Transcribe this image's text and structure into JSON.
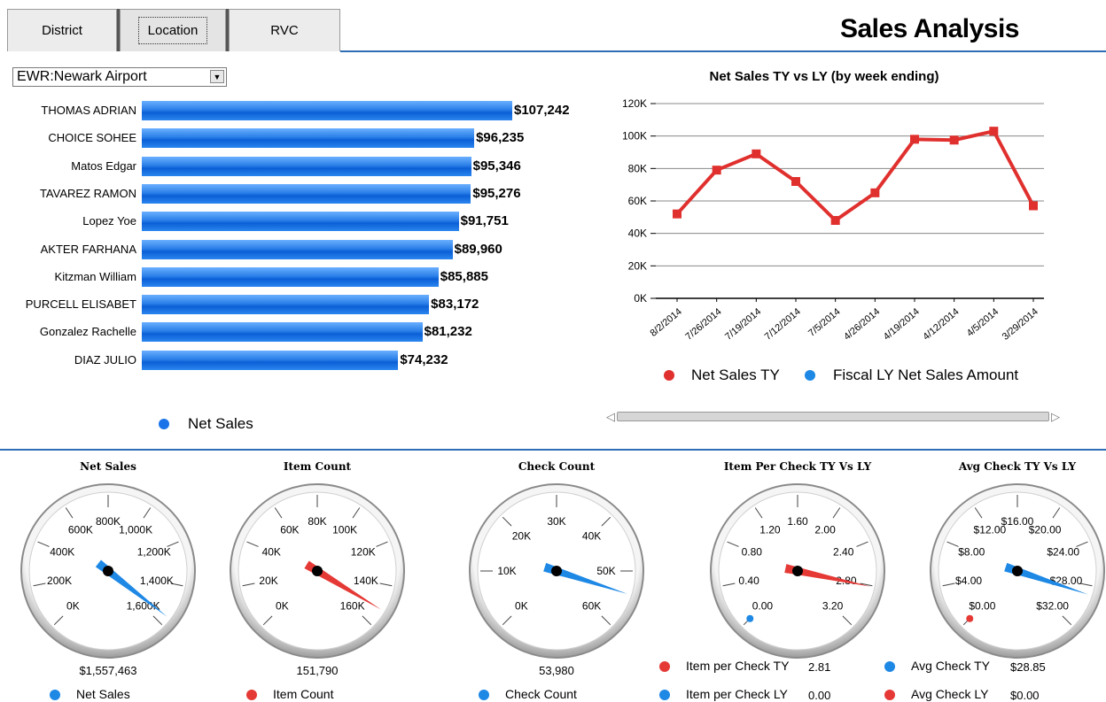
{
  "tabs": [
    "District",
    "Location",
    "RVC"
  ],
  "active_tab": 1,
  "title": "Sales Analysis",
  "location_select": {
    "value": "EWR:Newark Airport"
  },
  "bar_chart": {
    "type": "bar",
    "categories": [
      "THOMAS ADRIAN",
      "CHOICE SOHEE",
      "Matos Edgar",
      "TAVAREZ RAMON",
      "Lopez Yoe",
      "AKTER FARHANA",
      "Kitzman William",
      "PURCELL ELISABET",
      "Gonzalez Rachelle",
      "DIAZ JULIO"
    ],
    "values": [
      107242,
      96235,
      95346,
      95276,
      91751,
      89960,
      85885,
      83172,
      81232,
      74232
    ],
    "value_labels": [
      "$107,242",
      "$96,235",
      "$95,346",
      "$95,276",
      "$91,751",
      "$89,960",
      "$85,885",
      "$83,172",
      "$81,232",
      "$74,232"
    ],
    "legend": "Net Sales",
    "color": "#1a73e8"
  },
  "chart_data": {
    "type": "line",
    "title": "Net Sales TY vs LY (by week ending)",
    "x": [
      "8/2/2014",
      "7/26/2014",
      "7/19/2014",
      "7/12/2014",
      "7/5/2014",
      "4/26/2014",
      "4/19/2014",
      "4/12/2014",
      "4/5/2014",
      "3/29/2014"
    ],
    "series": [
      {
        "name": "Net Sales TY",
        "values": [
          52000,
          79000,
          89000,
          72000,
          48000,
          65000,
          98000,
          97500,
          103000,
          57000
        ],
        "color": "#e0302e"
      },
      {
        "name": "Fiscal LY Net Sales Amount",
        "values": [],
        "color": "#1e88e5"
      }
    ],
    "yticks": [
      "0K",
      "20K",
      "40K",
      "60K",
      "80K",
      "100K",
      "120K"
    ],
    "ylim": [
      0,
      120000
    ]
  },
  "gauges": [
    {
      "title": "Net Sales",
      "ticks": [
        "0K",
        "200K",
        "400K",
        "600K",
        "800K",
        "1,000K",
        "1,200K",
        "1,400K",
        "1,600K"
      ],
      "max": 1600000,
      "value_label": "$1,557,463",
      "needle_ty": 1557463,
      "needle_ly": null,
      "legend": [
        {
          "label": "Net Sales",
          "color": "#1e88e5",
          "value": ""
        }
      ]
    },
    {
      "title": "Item Count",
      "ticks": [
        "0K",
        "20K",
        "40K",
        "60K",
        "80K",
        "100K",
        "120K",
        "140K",
        "160K"
      ],
      "max": 160000,
      "value_label": "151,790",
      "needle_ty": 151790,
      "needle_ly": null,
      "needle_color": "#e53935",
      "legend": [
        {
          "label": "Item Count",
          "color": "#e53935",
          "value": ""
        }
      ]
    },
    {
      "title": "Check Count",
      "ticks": [
        "0K",
        "10K",
        "20K",
        "30K",
        "40K",
        "50K",
        "60K"
      ],
      "max": 60000,
      "value_label": "53,980",
      "needle_ty": 53980,
      "needle_ly": null,
      "legend": [
        {
          "label": "Check Count",
          "color": "#1e88e5",
          "value": ""
        }
      ]
    },
    {
      "title": "Item Per Check TY Vs LY",
      "ticks": [
        "0.00",
        "0.40",
        "0.80",
        "1.20",
        "1.60",
        "2.00",
        "2.40",
        "2.80",
        "3.20"
      ],
      "max": 3.2,
      "value_label": "",
      "needle_ty": 2.81,
      "needle_ly": 0.0,
      "needle_color": "#e53935",
      "ly_color": "#1e88e5",
      "legend": [
        {
          "label": "Item per Check TY",
          "color": "#e53935",
          "value": "2.81"
        },
        {
          "label": "Item per Check LY",
          "color": "#1e88e5",
          "value": "0.00"
        }
      ]
    },
    {
      "title": "Avg Check TY Vs LY",
      "ticks": [
        "$0.00",
        "$4.00",
        "$8.00",
        "$12.00",
        "$16.00",
        "$20.00",
        "$24.00",
        "$28.00",
        "$32.00"
      ],
      "max": 32,
      "value_label": "",
      "needle_ty": 28.85,
      "needle_ly": 0.0,
      "ly_color": "#e53935",
      "legend": [
        {
          "label": "Avg Check TY",
          "color": "#1e88e5",
          "value": "$28.85"
        },
        {
          "label": "Avg Check LY",
          "color": "#e53935",
          "value": "$0.00"
        }
      ]
    }
  ]
}
